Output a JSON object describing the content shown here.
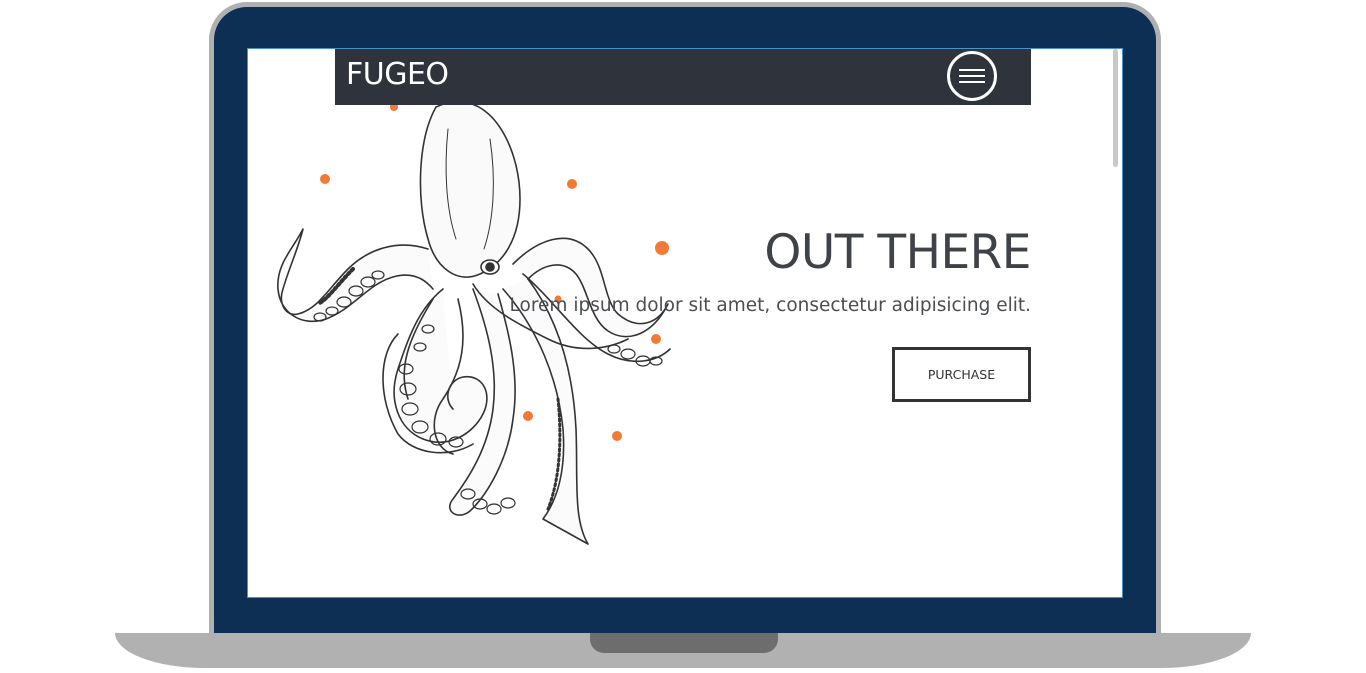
{
  "site": {
    "logo": "FUGEO",
    "menu_icon": "hamburger-menu-icon"
  },
  "hero": {
    "title": "OUT THERE",
    "subtitle": "Lorem ipsum dolor sit amet, consectetur adipisicing elit.",
    "button_label": "PURCHASE",
    "illustration": "octopus-illustration"
  },
  "colors": {
    "laptop_bezel": "#0d2f53",
    "laptop_body": "#aeb0b2",
    "header_bg": "#2f333c",
    "accent_dots": "#f07a36",
    "heading_text": "#3f4349"
  }
}
